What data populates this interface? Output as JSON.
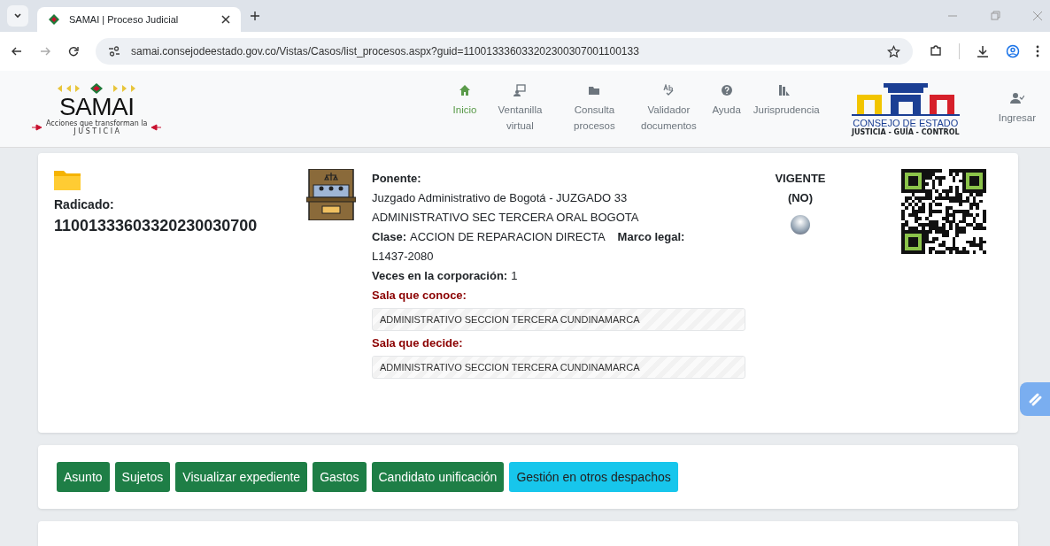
{
  "browser": {
    "tab": {
      "title": "SAMAI | Proceso Judicial"
    },
    "url": "samai.consejodeestado.gov.co/Vistas/Casos/list_procesos.aspx?guid=110013336033202300307001100133"
  },
  "header": {
    "logo": {
      "name": "SAMAI",
      "tagline": "Acciones que transforman la",
      "word": "J U S T I C I A"
    },
    "nav": [
      {
        "label": "Inicio",
        "kind": "home",
        "selected": true
      },
      {
        "label": "Ventanilla virtual",
        "kind": "screen",
        "selected": false
      },
      {
        "label": "Consulta procesos",
        "kind": "folder",
        "selected": false
      },
      {
        "label": "Validador documentos",
        "kind": "spell",
        "selected": false
      },
      {
        "label": "Ayuda",
        "kind": "help",
        "selected": false
      },
      {
        "label": "Jurisprudencia",
        "kind": "books",
        "selected": false
      }
    ],
    "seal": {
      "name": "CONSEJO DE ESTADO",
      "motto": "JUSTICIA - GUÍA - CONTROL"
    },
    "login": "Ingresar"
  },
  "case": {
    "radicado_label": "Radicado:",
    "radicado": "11001333603320230030700",
    "ponente_label": "Ponente:",
    "ponente": "Juzgado Administrativo de Bogotá - JUZGADO 33 ADMINISTRATIVO SEC TERCERA ORAL BOGOTA",
    "clase_label": "Clase:",
    "clase": "ACCION DE REPARACION DIRECTA",
    "marco_label": "Marco legal:",
    "marco": "L1437-2080",
    "veces_label": "Veces en la corporación:",
    "veces": "1",
    "salas": [
      {
        "label": "Sala que conoce:",
        "value": "ADMINISTRATIVO SECCION TERCERA CUNDINAMARCA"
      },
      {
        "label": "Sala que decide:",
        "value": "ADMINISTRATIVO SECCION TERCERA CUNDINAMARCA"
      }
    ],
    "vigente": {
      "label": "VIGENTE",
      "value": "(NO)",
      "on": false
    }
  },
  "actions": [
    {
      "label": "Asunto",
      "selected": false
    },
    {
      "label": "Sujetos",
      "selected": false
    },
    {
      "label": "Visualizar expediente",
      "selected": false
    },
    {
      "label": "Gastos",
      "selected": false
    },
    {
      "label": "Candidato unificación",
      "selected": false
    },
    {
      "label": "Gestión en otros despachos",
      "selected": true
    }
  ]
}
